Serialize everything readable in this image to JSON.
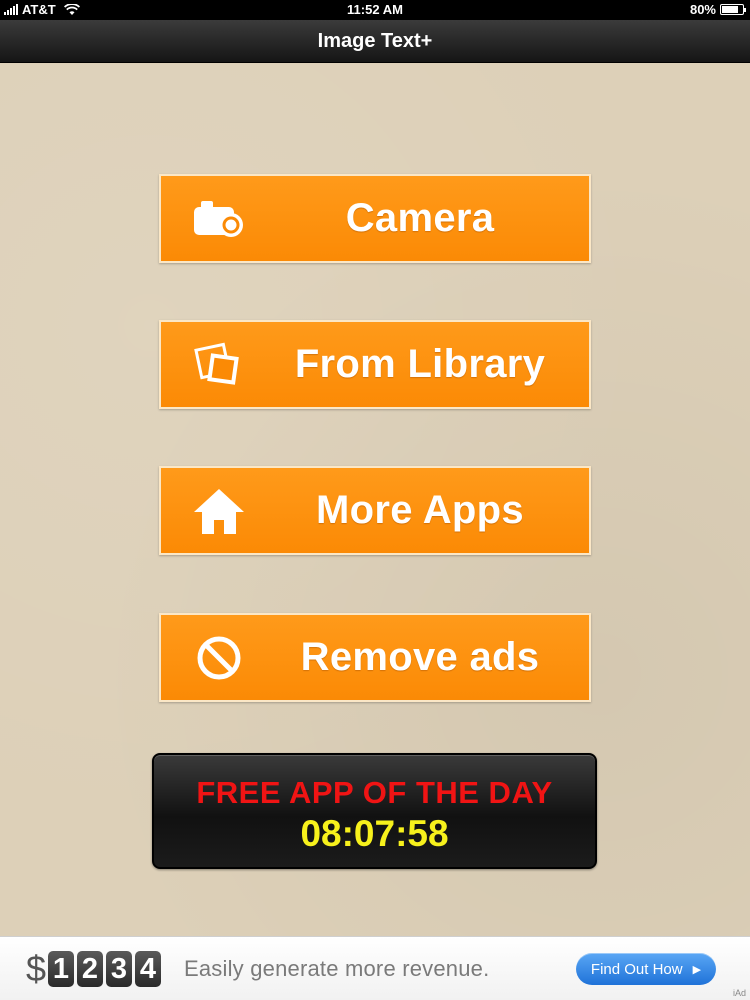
{
  "status_bar": {
    "carrier": "AT&T",
    "time": "11:52 AM",
    "battery": "80%",
    "battery_level": 0.8,
    "icons": [
      "signal-icon",
      "wifi-icon",
      "battery-icon"
    ]
  },
  "nav": {
    "title": "Image Text+"
  },
  "menu": {
    "camera": {
      "label": "Camera",
      "icon": "camera-icon"
    },
    "library": {
      "label": "From Library",
      "icon": "photos-icon"
    },
    "more_apps": {
      "label": "More Apps",
      "icon": "home-icon"
    },
    "remove_ads": {
      "label": "Remove ads",
      "icon": "no-sign-icon"
    }
  },
  "free_app": {
    "title": "FREE APP OF THE DAY",
    "timer": "08:07:58",
    "title_color": "#f01414",
    "timer_color": "#f7f11c"
  },
  "ad": {
    "currency": "$",
    "digits": [
      "1",
      "2",
      "3",
      "4"
    ],
    "text": "Easily generate more revenue.",
    "cta": "Find Out How",
    "badge": "iAd"
  },
  "colors": {
    "accent_orange": "#fb8a05",
    "background": "#ddd0b8",
    "ad_button_blue": "#1f72d8"
  }
}
